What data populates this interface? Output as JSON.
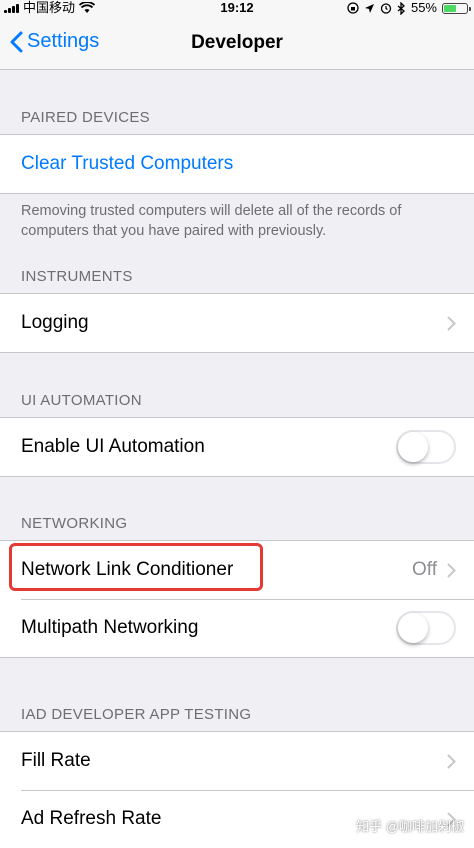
{
  "status_bar": {
    "carrier": "中国移动",
    "time": "19:12",
    "battery": "55%",
    "battery_level": 0.55
  },
  "nav": {
    "back_label": "Settings",
    "title": "Developer"
  },
  "sections": {
    "paired_devices": {
      "header": "PAIRED DEVICES",
      "clear_label": "Clear Trusted Computers",
      "footer": "Removing trusted computers will delete all of the records of computers that you have paired with previously."
    },
    "instruments": {
      "header": "INSTRUMENTS",
      "logging_label": "Logging"
    },
    "ui_automation": {
      "header": "UI AUTOMATION",
      "enable_label": "Enable UI Automation",
      "enable_on": false
    },
    "networking": {
      "header": "NETWORKING",
      "nlc_label": "Network Link Conditioner",
      "nlc_value": "Off",
      "multipath_label": "Multipath Networking",
      "multipath_on": false
    },
    "iad": {
      "header": "IAD DEVELOPER APP TESTING",
      "fill_rate_label": "Fill Rate",
      "ad_refresh_label": "Ad Refresh Rate"
    }
  },
  "watermark": "知乎 @咖啡加剁椒",
  "colors": {
    "accent": "#007aff",
    "highlight": "#e53935",
    "background": "#efeff4"
  }
}
